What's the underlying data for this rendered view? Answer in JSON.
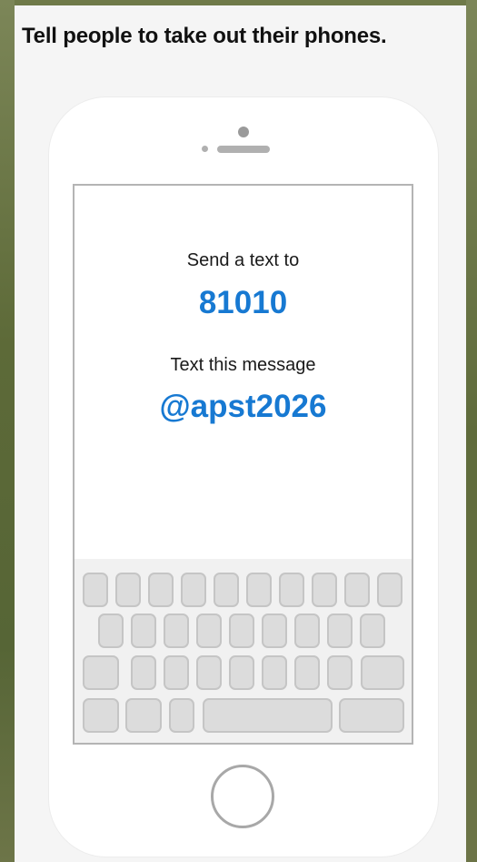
{
  "slide": {
    "headline": "Tell people to take out their phones."
  },
  "phone_screen": {
    "send_label": "Send a text to",
    "number": "81010",
    "message_label": "Text this message",
    "code": "@apst2026"
  },
  "colors": {
    "accent": "#1779d2",
    "background": "#5f6a3a",
    "slide": "#f5f5f5",
    "key": "#dcdcdc"
  },
  "icons": {
    "home_button": "home-button-icon"
  }
}
